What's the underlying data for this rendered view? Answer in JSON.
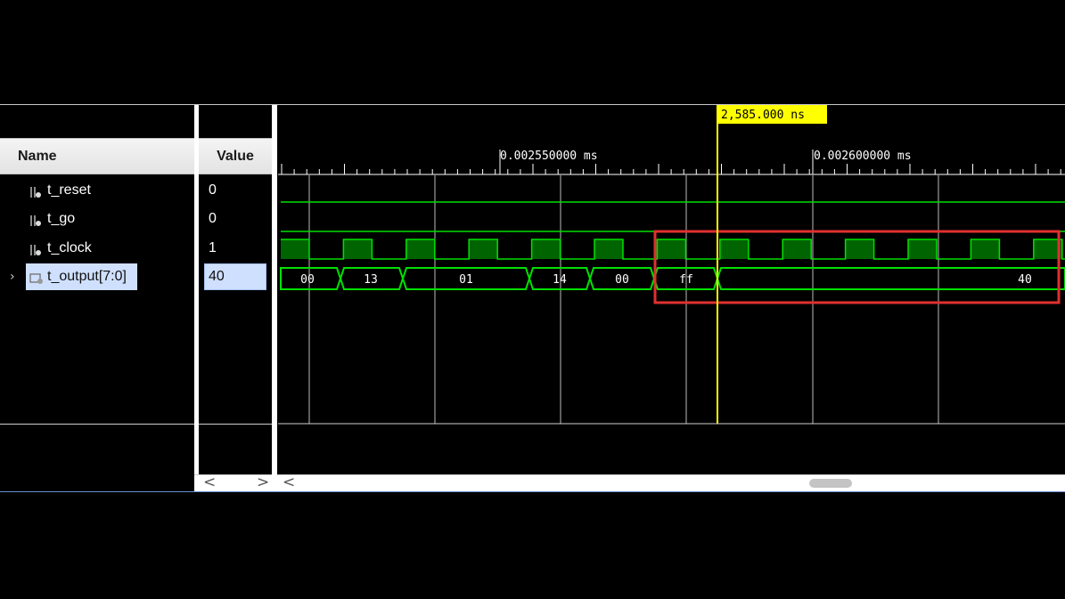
{
  "columns": {
    "name": "Name",
    "value": "Value"
  },
  "signals": [
    {
      "name": "t_reset",
      "value": "0",
      "icon": "logic-signal-icon",
      "selected": false
    },
    {
      "name": "t_go",
      "value": "0",
      "icon": "logic-signal-icon",
      "selected": false
    },
    {
      "name": "t_clock",
      "value": "1",
      "icon": "logic-signal-icon",
      "selected": false
    },
    {
      "name": "t_output[7:0]",
      "value": "40",
      "icon": "bus-signal-icon",
      "selected": true
    }
  ],
  "cursor": {
    "label": "2,585.000 ns",
    "color": "#ffff00"
  },
  "time_ruler": {
    "labels": [
      "0.002550000 ms",
      "0.002600000 ms"
    ]
  },
  "bus_values": [
    "00",
    "13",
    "01",
    "14",
    "00",
    "ff",
    "40"
  ],
  "colors": {
    "wave": "#00e000",
    "clock_fill": "#006400",
    "highlight_box": "#e03030",
    "cursor": "#ffff00"
  },
  "scroll_arrows": {
    "left": "<",
    "right": ">"
  }
}
